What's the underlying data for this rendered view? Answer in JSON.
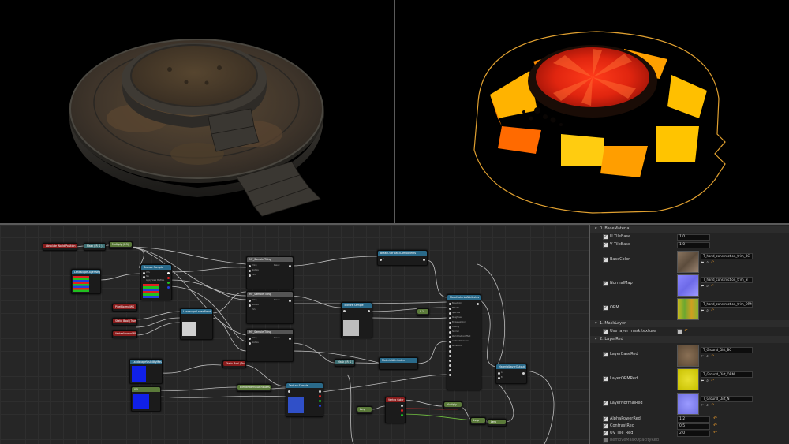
{
  "graph": {
    "nodes": {
      "abs_world_pos": "Absolute World Position",
      "mask": "Mask ( R G )",
      "multiply1": "Multiply (0.5)",
      "texture_sample1": "Texture Sample",
      "landscape_mask": "LandscapeLayerWeight",
      "mf_sample_tiling1": "MF_Sample Tiling",
      "mf_sample_tiling2": "MF_Sample Tiling",
      "mf_sample_tiling3": "MF_Sample Tiling",
      "param1": "PixelNormalWS",
      "param2": "Static Bool (True)",
      "param3": "VertexNormalWS",
      "landscape_coords": "LandscapeLayerBlend",
      "break_out": "BreakOutFloat3Components",
      "texture_sample2": "Texture Sample",
      "make_material": "MakeMaterialAttributes",
      "landscape_visible": "LandscapeVisibilityMask",
      "static_bool2": "Static Bool (True)",
      "const1": "0.5",
      "blend_material": "BlendMaterialAttributes",
      "texture_sample3": "Texture Sample",
      "mask2": "Mask ( R G )",
      "vertex_color": "Vertex Color",
      "lerp1": "Lerp",
      "output": "MaterialAttributes",
      "multiply2": "Multiply",
      "constant2": "0.1",
      "lerp2": "Lerp",
      "lerp3": "Lerp",
      "material_out": "MaterialLayerOutput"
    },
    "pins": {
      "uvs": "UVs",
      "tex": "Tex",
      "rgb": "RGB",
      "r": "R",
      "g": "G",
      "b": "B",
      "a": "A",
      "rgba": "RGBA",
      "apply_view_mip": "Apply View MipBias",
      "base_color": "BaseColor",
      "metallic": "Metallic",
      "specular": "Specular",
      "roughness": "Roughness",
      "normal": "Normal",
      "opacity": "Opacity",
      "emissive": "EmissiveColor",
      "world_pos_offset": "WorldPositionOffset",
      "ambient_occlusion": "AmbientOcclusion",
      "refraction": "Refraction",
      "alpha": "Alpha",
      "x": "X",
      "y": "Y",
      "z": "Z",
      "tiling": "Tiling",
      "texture": "Texture",
      "result": "Result",
      "att": "A",
      "btt": "B"
    }
  },
  "details": {
    "section_base": "0. BaseMaterial",
    "u_tilebase": "U TileBase",
    "u_tilebase_val": "1.0",
    "v_tilebase": "V TileBase",
    "v_tilebase_val": "1.0",
    "basecolor": "BaseColor",
    "basecolor_asset": "T_hand_construction_trim_BC",
    "normalmap": "NormalMap",
    "normalmap_asset": "T_hand_construction_trim_N",
    "orm": "ORM",
    "orm_asset": "T_hand_construction_trim_ORM",
    "section_mask": "1. MaskLayer",
    "use_mask": "Use layer mask texture",
    "section_layer": "2. LayerRed",
    "layer_basered": "LayerBaseRed",
    "layer_basered_asset": "T_Ground_Dirt_BC",
    "layer_ormred": "LayerORMRed",
    "layer_ormred_asset": "T_Ground_Dirt_ORM",
    "layer_normalred": "LayerNormalRed",
    "layer_normalred_asset": "T_Ground_Dirt_N",
    "alpha_power": "AlphaPowerRed",
    "alpha_power_val": "1.2",
    "contrast": "ContrastRed",
    "contrast_val": "0.5",
    "uv_tile": "UV Tile_Red",
    "uv_tile_val": "2.0",
    "remove_mask": "RemoveMaskOpacityRed"
  },
  "colors": {
    "hdr_red": "#8a1c1c",
    "hdr_green": "#5b7a3a",
    "hdr_blue": "#2a6a8a",
    "hdr_teal": "#3d6f73",
    "hdr_grey": "#555555",
    "wire": "#cfcfcf",
    "wire_red": "#c02a2a",
    "wire_green": "#6fbf3f",
    "accent_orange": "#e0a030"
  }
}
